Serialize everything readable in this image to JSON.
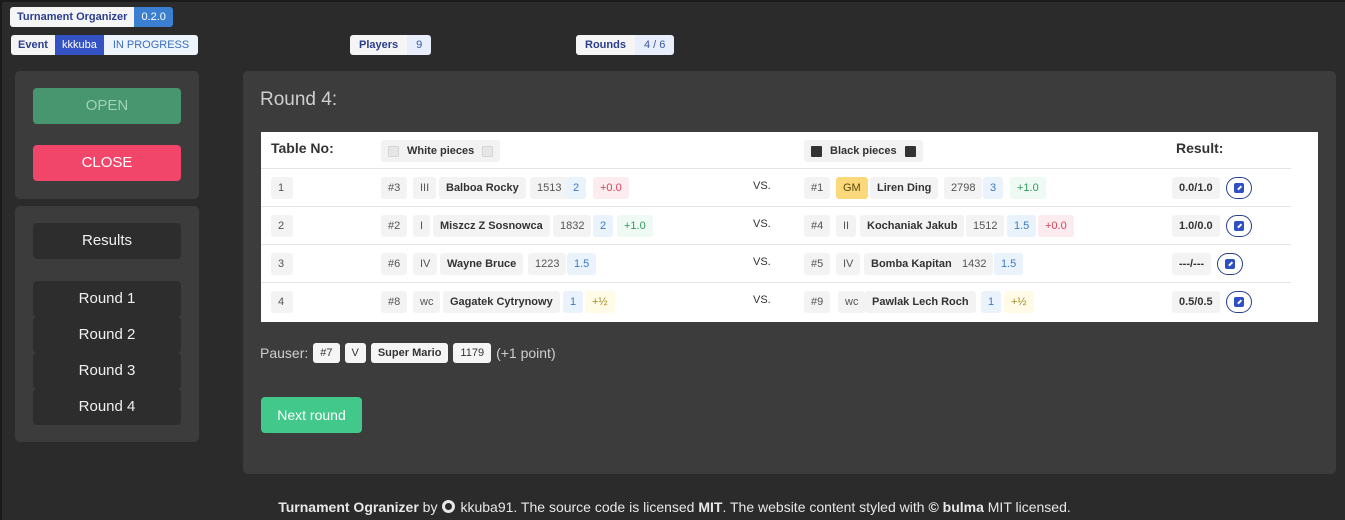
{
  "app": {
    "name": "Turnament Organizer",
    "version": "0.2.0"
  },
  "event": {
    "label": "Event",
    "name": "kkkuba",
    "status": "IN PROGRESS"
  },
  "players": {
    "label": "Players",
    "count": "9"
  },
  "rounds": {
    "label": "Rounds",
    "value": "4 / 6"
  },
  "sidebar": {
    "open_label": "OPEN",
    "close_label": "CLOSE",
    "results_label": "Results",
    "round_items": [
      "Round 1",
      "Round 2",
      "Round 3",
      "Round 4"
    ]
  },
  "main": {
    "title": "Round 4:",
    "headers": {
      "table_no": "Table No:",
      "white": "White pieces",
      "black": "Black pieces",
      "result": "Result:"
    },
    "vs_label": "VS.",
    "rows": [
      {
        "table": "1",
        "white": {
          "seed": "#3",
          "title": "III",
          "name": "Balboa Rocky",
          "rating": "1513",
          "points": "2",
          "delta": "+0.0",
          "delta_kind": "neg"
        },
        "black": {
          "seed": "#1",
          "title": "GM",
          "name": "Liren Ding",
          "rating": "2798",
          "points": "3",
          "delta": "+1.0",
          "delta_kind": "pos"
        },
        "result": "0.0/1.0"
      },
      {
        "table": "2",
        "white": {
          "seed": "#2",
          "title": "I",
          "name": "Miszcz Z Sosnowca",
          "rating": "1832",
          "points": "2",
          "delta": "+1.0",
          "delta_kind": "pos"
        },
        "black": {
          "seed": "#4",
          "title": "II",
          "name": "Kochaniak Jakub",
          "rating": "1512",
          "points": "1.5",
          "delta": "+0.0",
          "delta_kind": "neg"
        },
        "result": "1.0/0.0"
      },
      {
        "table": "3",
        "white": {
          "seed": "#6",
          "title": "IV",
          "name": "Wayne Bruce",
          "rating": "1223",
          "points": "1.5",
          "delta": "",
          "delta_kind": ""
        },
        "black": {
          "seed": "#5",
          "title": "IV",
          "name": "Bomba Kapitan",
          "rating": "1432",
          "points": "1.5",
          "delta": "",
          "delta_kind": ""
        },
        "result": "---/---"
      },
      {
        "table": "4",
        "white": {
          "seed": "#8",
          "title": "wc",
          "name": "Gagatek Cytrynowy",
          "rating": "",
          "points": "1",
          "delta": "+½",
          "delta_kind": "half"
        },
        "black": {
          "seed": "#9",
          "title": "wc",
          "name": "Pawlak Lech Roch",
          "rating": "",
          "points": "1",
          "delta": "+½",
          "delta_kind": "half"
        },
        "result": "0.5/0.5"
      }
    ],
    "pauser": {
      "label": "Pauser:",
      "seed": "#7",
      "title": "V",
      "name": "Super Mario",
      "rating": "1179",
      "note": "(+1 point)"
    },
    "next_round_label": "Next round"
  },
  "footer": {
    "app_name": "Turnament Ogranizer",
    "by": "by",
    "author": "kkuba91",
    "text1": ". The source code is licensed ",
    "license1": "MIT",
    "text2": ". The website content styled with ",
    "bulma": "© bulma",
    "text3": " MIT licensed."
  }
}
